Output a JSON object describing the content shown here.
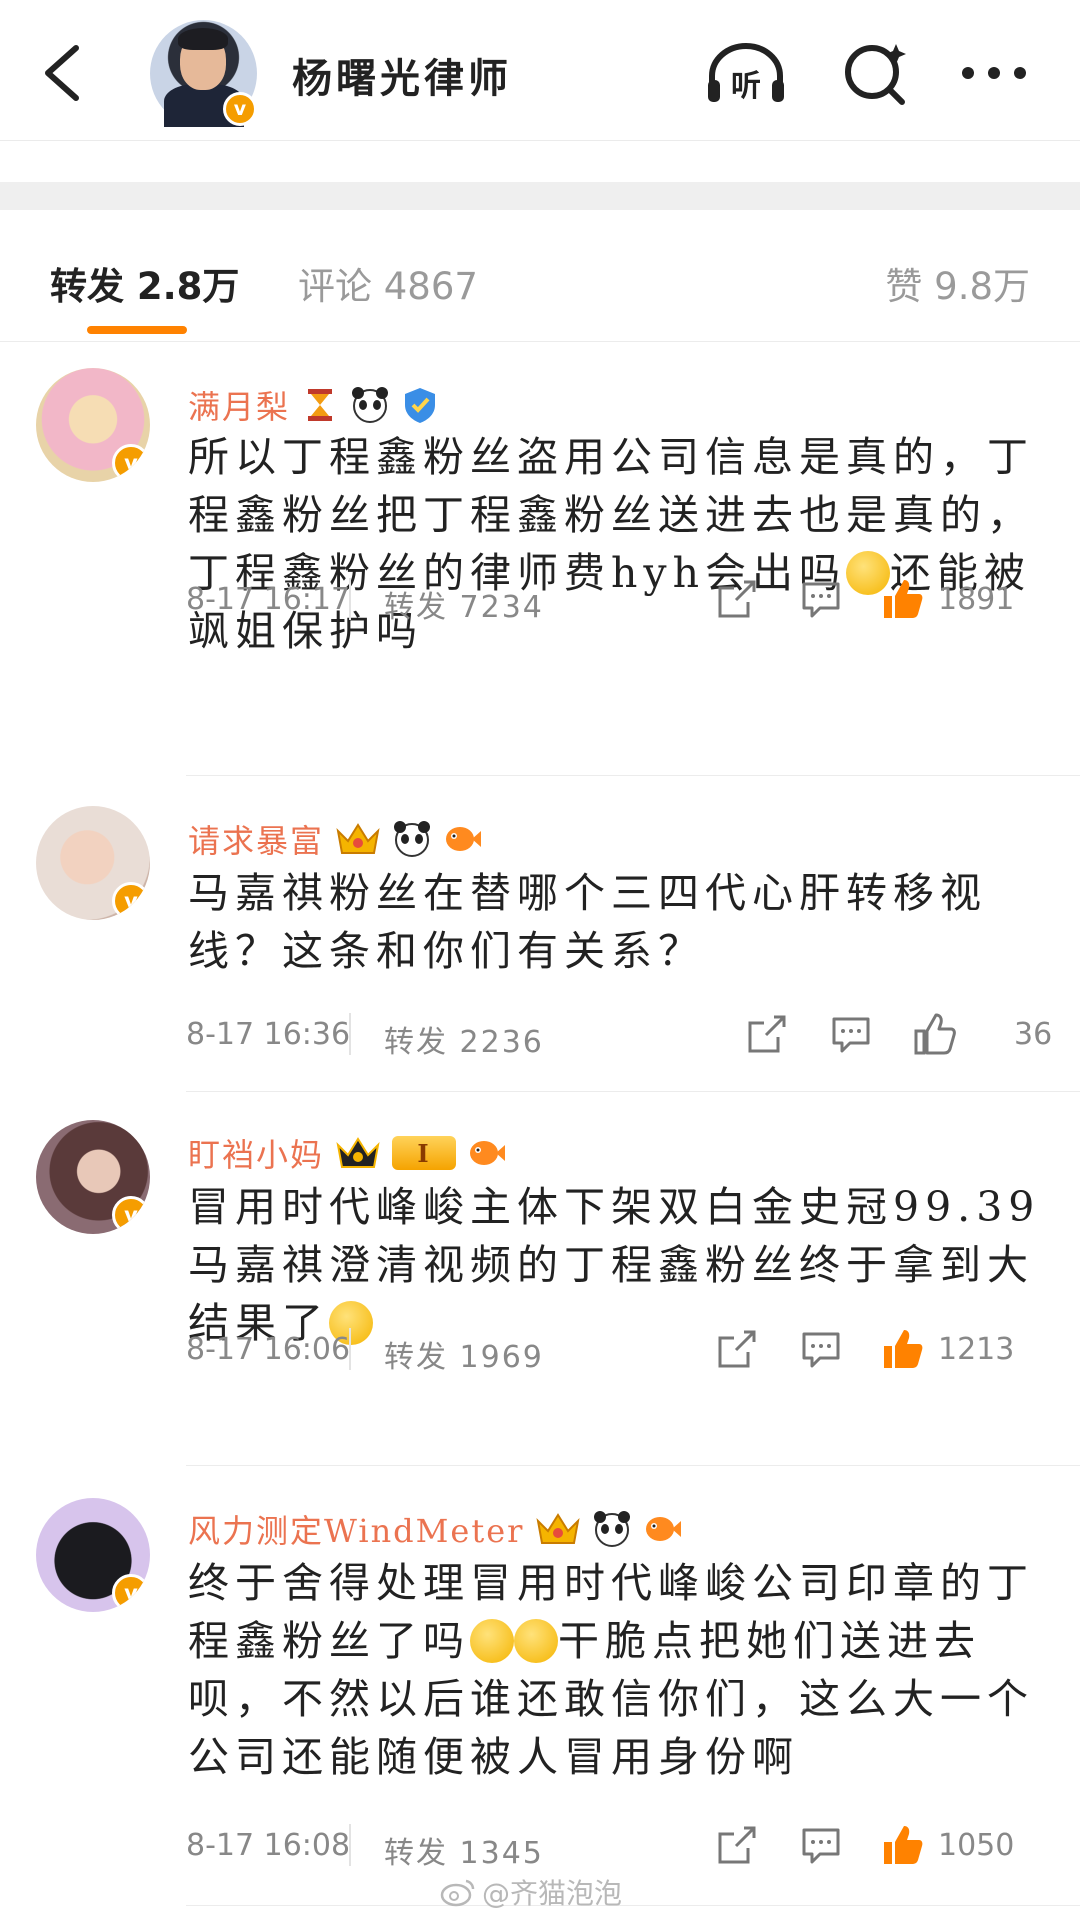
{
  "header": {
    "title": "杨曙光律师",
    "icons": [
      "back-arrow-icon",
      "listen-icon",
      "search-icon",
      "more-icon"
    ],
    "listen_label": "听"
  },
  "tabs": {
    "repost": "转发 2.8万",
    "comment": "评论 4867",
    "like": "赞 9.8万"
  },
  "items": [
    {
      "user": "满月梨",
      "text": "所以丁程鑫粉丝盗用公司信息是真的，丁程鑫粉丝把丁程鑫粉丝送进去也是真的，丁程鑫粉丝的律师费hyh会出吗",
      "text_tail": "还能被飒姐保护吗",
      "time": "8-17 16:17",
      "repost": "转发 7234",
      "likes": "1891",
      "liked": true
    },
    {
      "user": "请求暴富",
      "text": "马嘉祺粉丝在替哪个三四代心肝转移视线？这条和你们有关系？",
      "time": "8-17 16:36",
      "repost": "转发 2236",
      "likes": "36",
      "liked": false
    },
    {
      "user": "盯裆小妈",
      "text": "冒用时代峰峻主体下架双白金史冠99.39马嘉祺澄清视频的丁程鑫粉丝终于拿到大结果了",
      "level_badge": "I",
      "time": "8-17 16:06",
      "repost": "转发 1969",
      "likes": "1213",
      "liked": true
    },
    {
      "user": "风力测定WindMeter",
      "text_a": "终于舍得处理冒用时代峰峻公司印章的丁程鑫粉丝了吗",
      "text_b": "干脆点把她们送进去呗，不然以后谁还敢信你们，这么大一个公司还能随便被人冒用身份啊",
      "time": "8-17 16:08",
      "repost": "转发 1345",
      "likes": "1050",
      "liked": true
    }
  ],
  "watermark": "@齐猫泡泡",
  "colors": {
    "accent": "#ff8200",
    "username": "#eb7350",
    "verified": "#f59d00",
    "meta": "#888888"
  }
}
